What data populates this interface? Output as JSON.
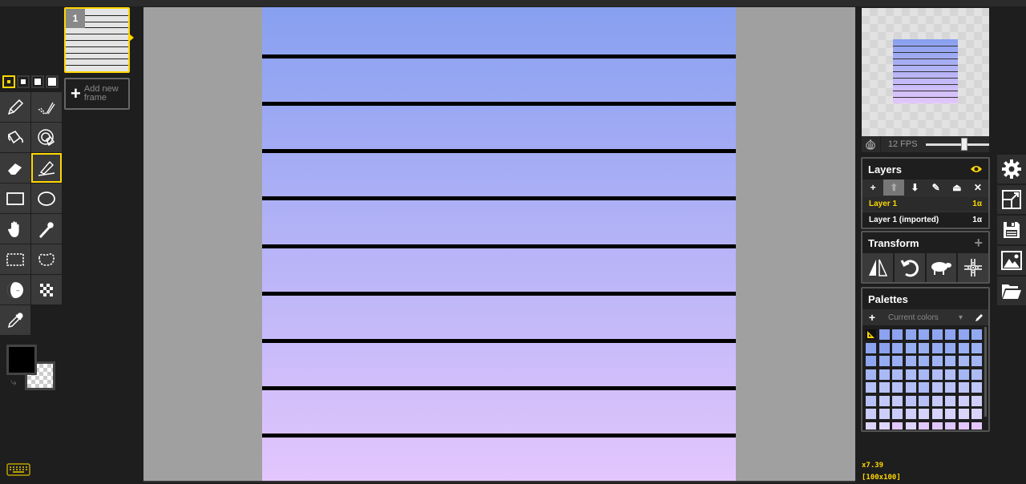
{
  "pen_sizes": [
    {
      "name": "pen-size-1",
      "active": true
    },
    {
      "name": "pen-size-2",
      "active": false
    },
    {
      "name": "pen-size-3",
      "active": false
    },
    {
      "name": "pen-size-4",
      "active": false
    }
  ],
  "tools": [
    {
      "name": "pen-tool",
      "icon": "pencil-icon"
    },
    {
      "name": "vertical-mirror-pen-tool",
      "icon": "mirror-pen-icon"
    },
    {
      "name": "paint-bucket-tool",
      "icon": "bucket-icon"
    },
    {
      "name": "paint-all-same-color-tool",
      "icon": "bucket-target-icon"
    },
    {
      "name": "eraser-tool",
      "icon": "eraser-icon"
    },
    {
      "name": "stroke-tool",
      "icon": "stroke-icon",
      "active": true
    },
    {
      "name": "rectangle-tool",
      "icon": "rectangle-icon"
    },
    {
      "name": "circle-tool",
      "icon": "circle-icon"
    },
    {
      "name": "move-tool",
      "icon": "hand-icon"
    },
    {
      "name": "shape-selection-tool",
      "icon": "magic-wand-icon"
    },
    {
      "name": "rectangle-selection-tool",
      "icon": "rect-select-icon"
    },
    {
      "name": "lasso-selection-tool",
      "icon": "lasso-icon"
    },
    {
      "name": "lighten-tool",
      "icon": "lighten-darken-icon"
    },
    {
      "name": "dithering-tool",
      "icon": "dither-icon"
    },
    {
      "name": "color-picker-tool",
      "icon": "eyedropper-icon"
    }
  ],
  "colors": {
    "primary": "#000000",
    "secondary": "transparent",
    "accent": "#ffd700"
  },
  "frames": {
    "items": [
      {
        "number": "1"
      }
    ],
    "add_label": "Add new frame"
  },
  "canvas": {
    "gradient_top": "#87a0f0",
    "gradient_bottom": "#e3c6fd",
    "line_count": 9
  },
  "preview": {
    "fps_label": "12 FPS",
    "fps_value": 12,
    "fps_fraction": 0.6
  },
  "layers": {
    "title": "Layers",
    "toolbar": [
      "+",
      "⬆",
      "⬇",
      "✎",
      "⏏",
      "✕"
    ],
    "items": [
      {
        "name": "Layer 1",
        "opacity": "1α",
        "active": true
      },
      {
        "name": "Layer 1 (imported)",
        "opacity": "1α",
        "active": false
      }
    ]
  },
  "transform": {
    "title": "Transform",
    "tools": [
      "flip-icon",
      "rotate-icon",
      "clone-sheep-icon",
      "center-icon"
    ]
  },
  "palettes": {
    "title": "Palettes",
    "selected": "Current colors",
    "swatches": [
      "#8ba2ef",
      "#8da3f0",
      "#8ea6f0",
      "#90a7f1",
      "#8fa5f0",
      "#8ea4f0",
      "#90a6f1",
      "#92a9f1",
      "#8ea5f0",
      "#8ba1ef",
      "#94abf2",
      "#97aef2",
      "#99aff2",
      "#95acf2",
      "#93aaf1",
      "#9ab0f3",
      "#9cb1f3",
      "#8fa6f0",
      "#97adf2",
      "#99b0f3",
      "#9fb3f3",
      "#9db2f3",
      "#a0b4f4",
      "#a2b5f4",
      "#a6b7f4",
      "#a4b5f4",
      "#a3b5f4",
      "#a9b9f5",
      "#abbaf5",
      "#aebcf5",
      "#a8b8f5",
      "#b0bdf6",
      "#b2bff6",
      "#a5b6f4",
      "#adbbf5",
      "#b4c0f6",
      "#b8c2f7",
      "#b5c1f6",
      "#b3bff6",
      "#abb9f5",
      "#bac3f7",
      "#b9c2f7",
      "#bdc4f7",
      "#bfc6f8",
      "#b7c1f7",
      "#c2c8f8",
      "#c4c9f8",
      "#bbc3f7",
      "#b6c0f7",
      "#c6caf8",
      "#c8cbf9",
      "#cfcefa",
      "#d0cffa",
      "#cbcdf9",
      "#cdcdf9",
      "#c9ccf9",
      "#d2d0fa",
      "#d4d1fa",
      "#d6d2fb",
      "#d8d3fb",
      "#dad4fb",
      "#d9d3fb",
      "#dcd5fb",
      "#ded6fc",
      "#e0c7fd",
      "#ddd5fb",
      "#e1c8fd",
      "#e2c7fd",
      "#dfc6fc",
      "#e3c6fd",
      "#e4c8fd",
      "#e5c9fd"
    ]
  },
  "side_buttons": [
    "gear-icon",
    "resize-icon",
    "save-icon",
    "export-image-icon",
    "open-folder-icon"
  ],
  "zoom_info": {
    "zoom": "x7.39",
    "size": "[100x100]"
  }
}
